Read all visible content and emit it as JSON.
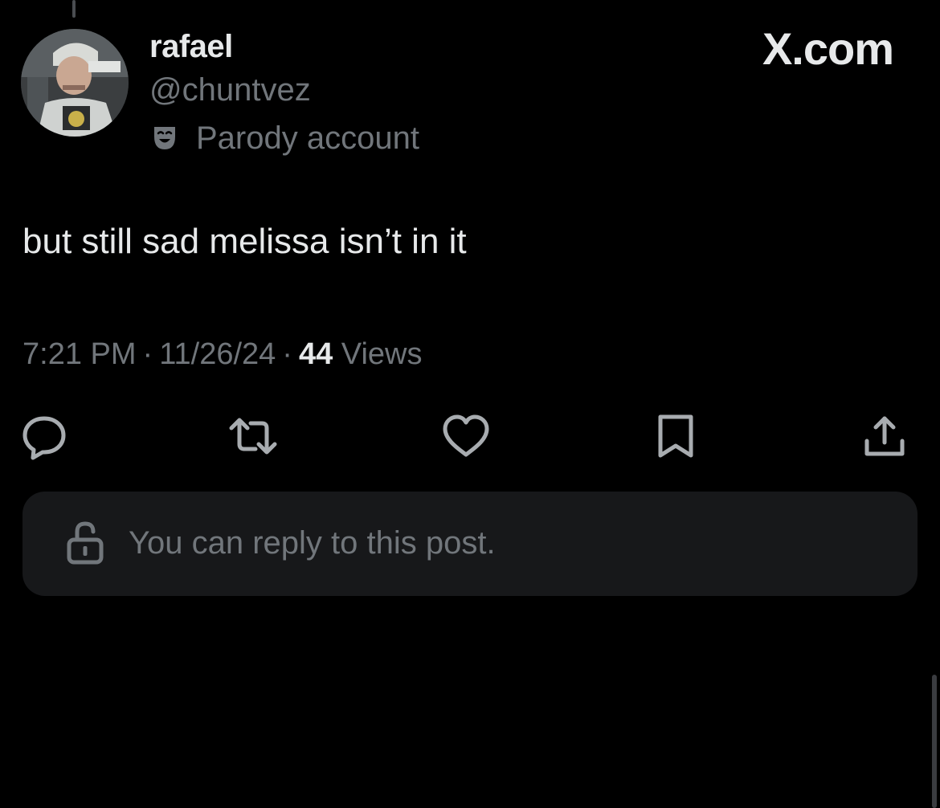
{
  "header": {
    "display_name": "rafael",
    "handle": "@chuntvez",
    "parody_label": "Parody account",
    "watermark": "X.com"
  },
  "post": {
    "text": "but still sad melissa isn’t in it",
    "time": "7:21 PM",
    "date": "11/26/24",
    "views_count": "44",
    "views_label": "Views"
  },
  "actions": {
    "icons": [
      "reply-icon",
      "repost-icon",
      "like-icon",
      "bookmark-icon",
      "share-icon"
    ]
  },
  "reply_box": {
    "text": "You can reply to this post."
  },
  "colors": {
    "background": "#000000",
    "primary_text": "#e7e9ea",
    "secondary_text": "#71767b",
    "reply_box_bg": "#17181a"
  }
}
